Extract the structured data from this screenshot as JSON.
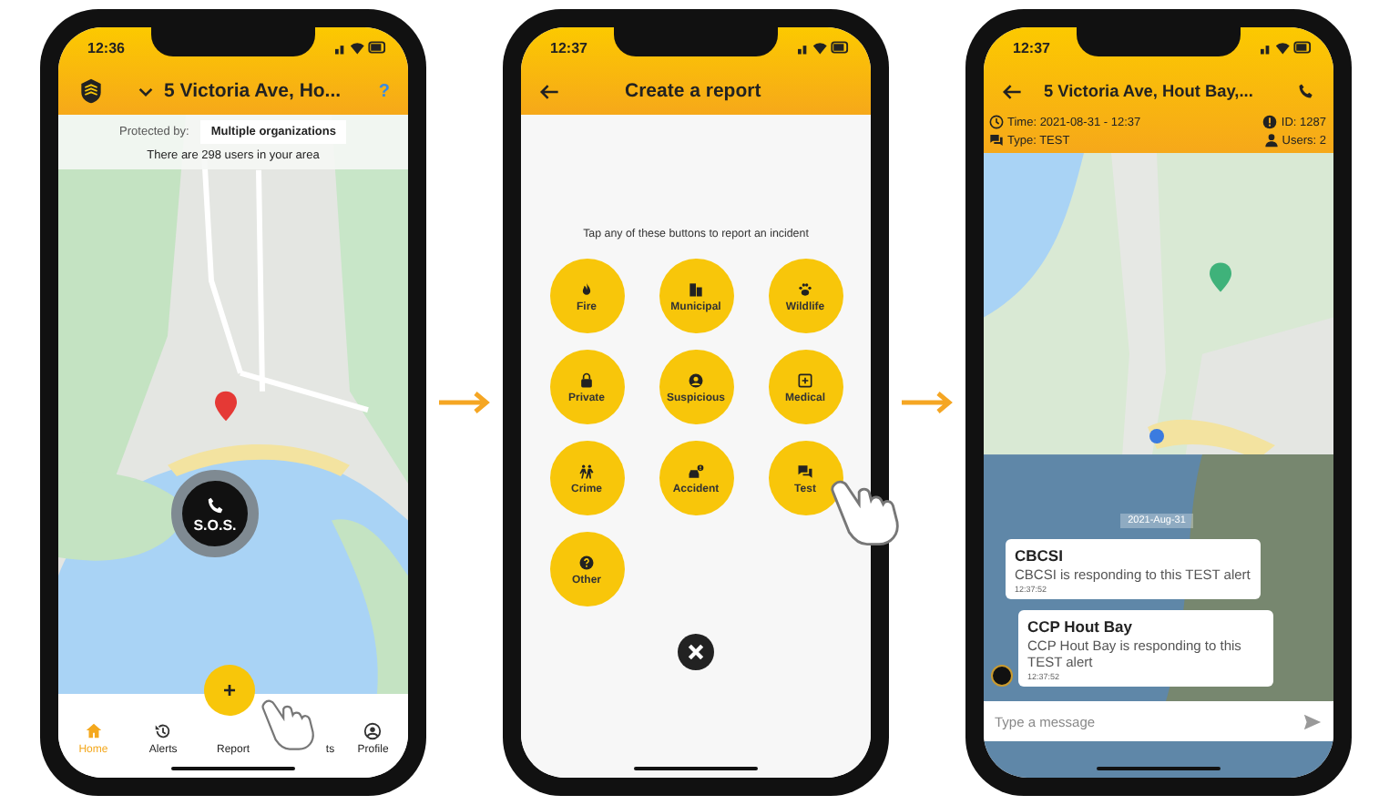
{
  "home_screen": {
    "status_time": "12:36",
    "address": "5 Victoria Ave, Ho...",
    "help": "?",
    "protected_label": "Protected by:",
    "protected_value": "Multiple organizations",
    "users_note": "There are 298 users in your area",
    "sos_label": "S.O.S.",
    "fab": "+",
    "nav": [
      {
        "label": "Home",
        "selected": true
      },
      {
        "label": "Alerts",
        "selected": false
      },
      {
        "label": "Report",
        "selected": false
      },
      {
        "label": "ts",
        "selected": false
      },
      {
        "label": "Profile",
        "selected": false
      }
    ]
  },
  "report_screen": {
    "status_time": "12:37",
    "title": "Create a report",
    "instruction": "Tap any of these buttons to report an incident",
    "buttons": [
      {
        "label": "Fire"
      },
      {
        "label": "Municipal"
      },
      {
        "label": "Wildlife"
      },
      {
        "label": "Private"
      },
      {
        "label": "Suspicious"
      },
      {
        "label": "Medical"
      },
      {
        "label": "Crime"
      },
      {
        "label": "Accident"
      },
      {
        "label": "Test"
      },
      {
        "label": "Other"
      }
    ]
  },
  "alert_screen": {
    "status_time": "12:37",
    "address": "5 Victoria Ave, Hout Bay,...",
    "time": "Time: 2021-08-31 - 12:37",
    "id": "ID: 1287",
    "type": "Type: TEST",
    "users": "Users: 2",
    "date": "2021-Aug-31",
    "messages": [
      {
        "sender": "CBCSI",
        "text": "CBCSI is responding to this TEST alert",
        "time": "12:37:52"
      },
      {
        "sender": "CCP Hout Bay",
        "text": "CCP Hout Bay is responding to this TEST alert",
        "time": "12:37:52"
      }
    ],
    "input": {
      "placeholder": "Type a message"
    }
  }
}
